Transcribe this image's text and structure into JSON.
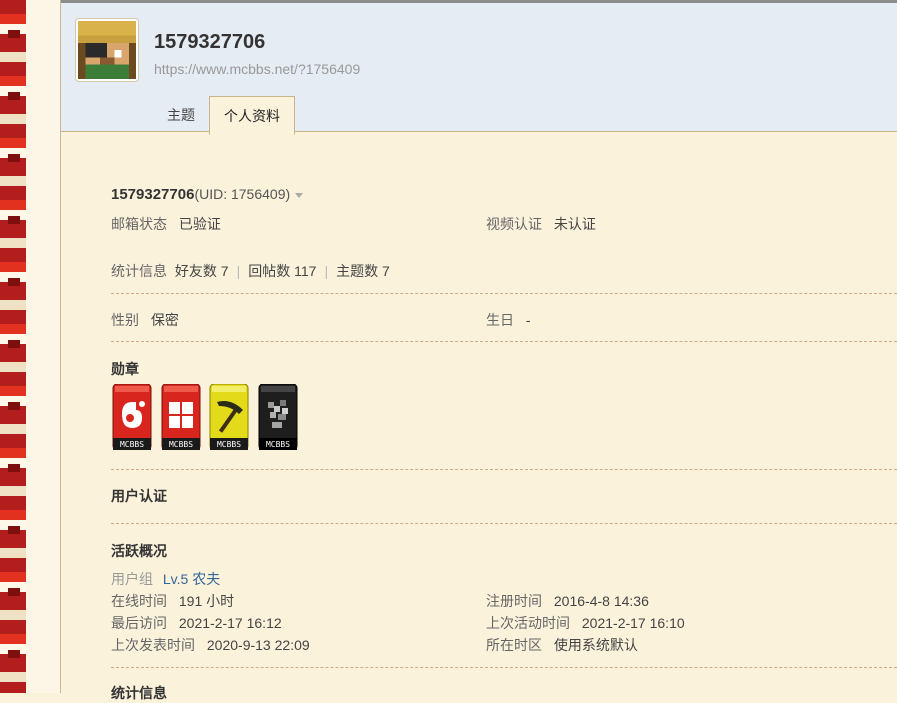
{
  "header": {
    "username": "1579327706",
    "url": "https://www.mcbbs.net/?1756409",
    "tabs": [
      {
        "label": "主题",
        "active": false
      },
      {
        "label": "个人资料",
        "active": true
      }
    ]
  },
  "profile": {
    "name": "1579327706",
    "uid_text": "(UID: 1756409)",
    "email_label": "邮箱状态",
    "email_value": "已验证",
    "video_label": "视频认证",
    "video_value": "未认证",
    "stats_label": "统计信息",
    "friends": "好友数 7",
    "replies": "回帖数 117",
    "threads": "主题数 7",
    "gender_label": "性别",
    "gender_value": "保密",
    "birthday_label": "生日",
    "birthday_value": "-"
  },
  "medals": {
    "title": "勋章",
    "items": [
      {
        "name": "medal-red-drop",
        "caption": "MCBBS",
        "color": "#d8261e"
      },
      {
        "name": "medal-red-window",
        "caption": "MCBBS",
        "color": "#d8261e"
      },
      {
        "name": "medal-yellow-pickaxe",
        "caption": "MCBBS",
        "color": "#e3db1a"
      },
      {
        "name": "medal-black-ore",
        "caption": "MCBBS",
        "color": "#1e1e1e"
      }
    ]
  },
  "verification": {
    "title": "用户认证"
  },
  "activity": {
    "title": "活跃概况",
    "group_label": "用户组",
    "group_value": "Lv.5 农夫",
    "online_label": "在线时间",
    "online_value": "191 小时",
    "register_label": "注册时间",
    "register_value": "2016-4-8 14:36",
    "last_visit_label": "最后访问",
    "last_visit_value": "2021-2-17 16:12",
    "last_active_label": "上次活动时间",
    "last_active_value": "2021-2-17 16:10",
    "last_post_label": "上次发表时间",
    "last_post_value": "2020-9-13 22:09",
    "timezone_label": "所在时区",
    "timezone_value": "使用系统默认"
  },
  "stats_section": {
    "title": "统计信息"
  }
}
